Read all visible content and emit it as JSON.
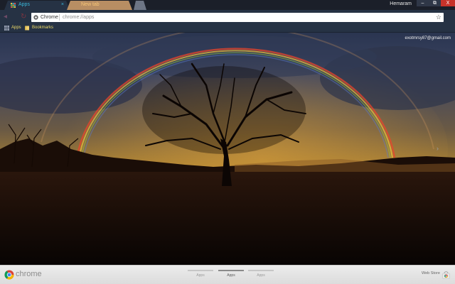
{
  "tabs": [
    {
      "label": "Apps",
      "close": "×"
    },
    {
      "label": "New tab"
    }
  ],
  "window": {
    "user": "Hemaram",
    "minimize": "–",
    "maximize": "⧉",
    "close": "X"
  },
  "toolbar": {
    "back": "◂",
    "forward": "▸",
    "reload": "↻",
    "site_label": "Chrome",
    "url": "chrome://apps",
    "star": "☆"
  },
  "bookmarks": [
    {
      "label": "Apps",
      "icon": "apps-grid-icon"
    },
    {
      "label": "Bookmarks",
      "icon": "folder-icon"
    }
  ],
  "page": {
    "account_email": "exotmrsy87@gmail.com",
    "next_arrow": "›"
  },
  "bottom_bar": {
    "brand": "chrome",
    "page_tabs": [
      "Apps",
      "Apps",
      "Apps"
    ],
    "active_page": 1,
    "webstore_label": "Web Store"
  },
  "colors": {
    "active_tab": "#263244",
    "tab_text": "#38b6d8",
    "bookmark_text": "#eedc6a",
    "close_button": "#c8332a"
  }
}
